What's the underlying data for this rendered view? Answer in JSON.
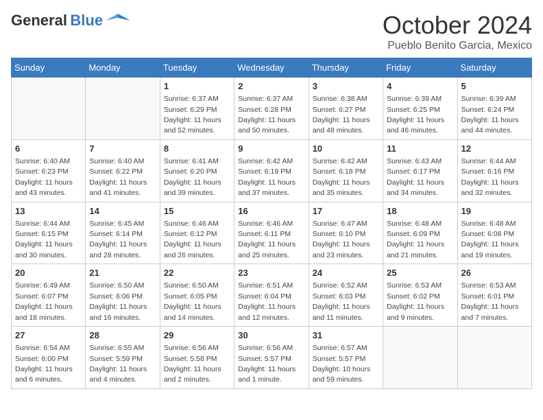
{
  "header": {
    "logo_general": "General",
    "logo_blue": "Blue",
    "month": "October 2024",
    "location": "Pueblo Benito Garcia, Mexico"
  },
  "days_of_week": [
    "Sunday",
    "Monday",
    "Tuesday",
    "Wednesday",
    "Thursday",
    "Friday",
    "Saturday"
  ],
  "weeks": [
    [
      {
        "day": "",
        "empty": true
      },
      {
        "day": "",
        "empty": true
      },
      {
        "day": "1",
        "sunrise": "Sunrise: 6:37 AM",
        "sunset": "Sunset: 6:29 PM",
        "daylight": "Daylight: 11 hours and 52 minutes."
      },
      {
        "day": "2",
        "sunrise": "Sunrise: 6:37 AM",
        "sunset": "Sunset: 6:28 PM",
        "daylight": "Daylight: 11 hours and 50 minutes."
      },
      {
        "day": "3",
        "sunrise": "Sunrise: 6:38 AM",
        "sunset": "Sunset: 6:27 PM",
        "daylight": "Daylight: 11 hours and 48 minutes."
      },
      {
        "day": "4",
        "sunrise": "Sunrise: 6:39 AM",
        "sunset": "Sunset: 6:25 PM",
        "daylight": "Daylight: 11 hours and 46 minutes."
      },
      {
        "day": "5",
        "sunrise": "Sunrise: 6:39 AM",
        "sunset": "Sunset: 6:24 PM",
        "daylight": "Daylight: 11 hours and 44 minutes."
      }
    ],
    [
      {
        "day": "6",
        "sunrise": "Sunrise: 6:40 AM",
        "sunset": "Sunset: 6:23 PM",
        "daylight": "Daylight: 11 hours and 43 minutes."
      },
      {
        "day": "7",
        "sunrise": "Sunrise: 6:40 AM",
        "sunset": "Sunset: 6:22 PM",
        "daylight": "Daylight: 11 hours and 41 minutes."
      },
      {
        "day": "8",
        "sunrise": "Sunrise: 6:41 AM",
        "sunset": "Sunset: 6:20 PM",
        "daylight": "Daylight: 11 hours and 39 minutes."
      },
      {
        "day": "9",
        "sunrise": "Sunrise: 6:42 AM",
        "sunset": "Sunset: 6:19 PM",
        "daylight": "Daylight: 11 hours and 37 minutes."
      },
      {
        "day": "10",
        "sunrise": "Sunrise: 6:42 AM",
        "sunset": "Sunset: 6:18 PM",
        "daylight": "Daylight: 11 hours and 35 minutes."
      },
      {
        "day": "11",
        "sunrise": "Sunrise: 6:43 AM",
        "sunset": "Sunset: 6:17 PM",
        "daylight": "Daylight: 11 hours and 34 minutes."
      },
      {
        "day": "12",
        "sunrise": "Sunrise: 6:44 AM",
        "sunset": "Sunset: 6:16 PM",
        "daylight": "Daylight: 11 hours and 32 minutes."
      }
    ],
    [
      {
        "day": "13",
        "sunrise": "Sunrise: 6:44 AM",
        "sunset": "Sunset: 6:15 PM",
        "daylight": "Daylight: 11 hours and 30 minutes."
      },
      {
        "day": "14",
        "sunrise": "Sunrise: 6:45 AM",
        "sunset": "Sunset: 6:14 PM",
        "daylight": "Daylight: 11 hours and 28 minutes."
      },
      {
        "day": "15",
        "sunrise": "Sunrise: 6:46 AM",
        "sunset": "Sunset: 6:12 PM",
        "daylight": "Daylight: 11 hours and 26 minutes."
      },
      {
        "day": "16",
        "sunrise": "Sunrise: 6:46 AM",
        "sunset": "Sunset: 6:11 PM",
        "daylight": "Daylight: 11 hours and 25 minutes."
      },
      {
        "day": "17",
        "sunrise": "Sunrise: 6:47 AM",
        "sunset": "Sunset: 6:10 PM",
        "daylight": "Daylight: 11 hours and 23 minutes."
      },
      {
        "day": "18",
        "sunrise": "Sunrise: 6:48 AM",
        "sunset": "Sunset: 6:09 PM",
        "daylight": "Daylight: 11 hours and 21 minutes."
      },
      {
        "day": "19",
        "sunrise": "Sunrise: 6:48 AM",
        "sunset": "Sunset: 6:08 PM",
        "daylight": "Daylight: 11 hours and 19 minutes."
      }
    ],
    [
      {
        "day": "20",
        "sunrise": "Sunrise: 6:49 AM",
        "sunset": "Sunset: 6:07 PM",
        "daylight": "Daylight: 11 hours and 18 minutes."
      },
      {
        "day": "21",
        "sunrise": "Sunrise: 6:50 AM",
        "sunset": "Sunset: 6:06 PM",
        "daylight": "Daylight: 11 hours and 16 minutes."
      },
      {
        "day": "22",
        "sunrise": "Sunrise: 6:50 AM",
        "sunset": "Sunset: 6:05 PM",
        "daylight": "Daylight: 11 hours and 14 minutes."
      },
      {
        "day": "23",
        "sunrise": "Sunrise: 6:51 AM",
        "sunset": "Sunset: 6:04 PM",
        "daylight": "Daylight: 11 hours and 12 minutes."
      },
      {
        "day": "24",
        "sunrise": "Sunrise: 6:52 AM",
        "sunset": "Sunset: 6:03 PM",
        "daylight": "Daylight: 11 hours and 11 minutes."
      },
      {
        "day": "25",
        "sunrise": "Sunrise: 6:53 AM",
        "sunset": "Sunset: 6:02 PM",
        "daylight": "Daylight: 11 hours and 9 minutes."
      },
      {
        "day": "26",
        "sunrise": "Sunrise: 6:53 AM",
        "sunset": "Sunset: 6:01 PM",
        "daylight": "Daylight: 11 hours and 7 minutes."
      }
    ],
    [
      {
        "day": "27",
        "sunrise": "Sunrise: 6:54 AM",
        "sunset": "Sunset: 6:00 PM",
        "daylight": "Daylight: 11 hours and 6 minutes."
      },
      {
        "day": "28",
        "sunrise": "Sunrise: 6:55 AM",
        "sunset": "Sunset: 5:59 PM",
        "daylight": "Daylight: 11 hours and 4 minutes."
      },
      {
        "day": "29",
        "sunrise": "Sunrise: 6:56 AM",
        "sunset": "Sunset: 5:58 PM",
        "daylight": "Daylight: 11 hours and 2 minutes."
      },
      {
        "day": "30",
        "sunrise": "Sunrise: 6:56 AM",
        "sunset": "Sunset: 5:57 PM",
        "daylight": "Daylight: 11 hours and 1 minute."
      },
      {
        "day": "31",
        "sunrise": "Sunrise: 6:57 AM",
        "sunset": "Sunset: 5:57 PM",
        "daylight": "Daylight: 10 hours and 59 minutes."
      },
      {
        "day": "",
        "empty": true
      },
      {
        "day": "",
        "empty": true
      }
    ]
  ]
}
